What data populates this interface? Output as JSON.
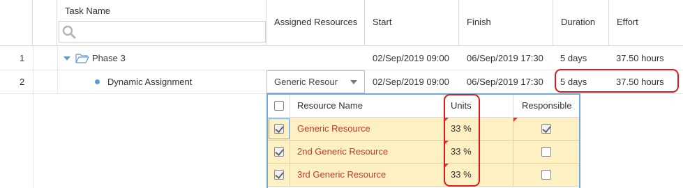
{
  "columns": {
    "task_name": "Task Name",
    "assigned_resources": "Assigned Resources",
    "start": "Start",
    "finish": "Finish",
    "duration": "Duration",
    "effort": "Effort"
  },
  "search": {
    "placeholder": "",
    "value": ""
  },
  "rows": [
    {
      "num": "1",
      "name": "Phase 3",
      "assigned": "",
      "start": "02/Sep/2019 09:00",
      "finish": "06/Sep/2019 17:30",
      "duration": "5 days",
      "effort": "37.50 hours"
    },
    {
      "num": "2",
      "name": "Dynamic Assignment",
      "assigned": "Generic Resour",
      "start": "02/Sep/2019 09:00",
      "finish": "06/Sep/2019 17:30",
      "duration": "5 days",
      "effort": "37.50 hours"
    }
  ],
  "resource_popup": {
    "headers": {
      "name": "Resource Name",
      "units": "Units",
      "responsible": "Responsible"
    },
    "items": [
      {
        "name": "Generic Resource",
        "units": "33 %",
        "selected": true,
        "responsible": true
      },
      {
        "name": "2nd Generic Resource",
        "units": "33 %",
        "selected": true,
        "responsible": false
      },
      {
        "name": "3rd Generic Resource",
        "units": "33 %",
        "selected": true,
        "responsible": false
      }
    ]
  },
  "colors": {
    "accent": "#5b9bd5",
    "highlight": "#e01919",
    "row_selected": "#fdf1c4",
    "resource_name": "#c0392b"
  }
}
